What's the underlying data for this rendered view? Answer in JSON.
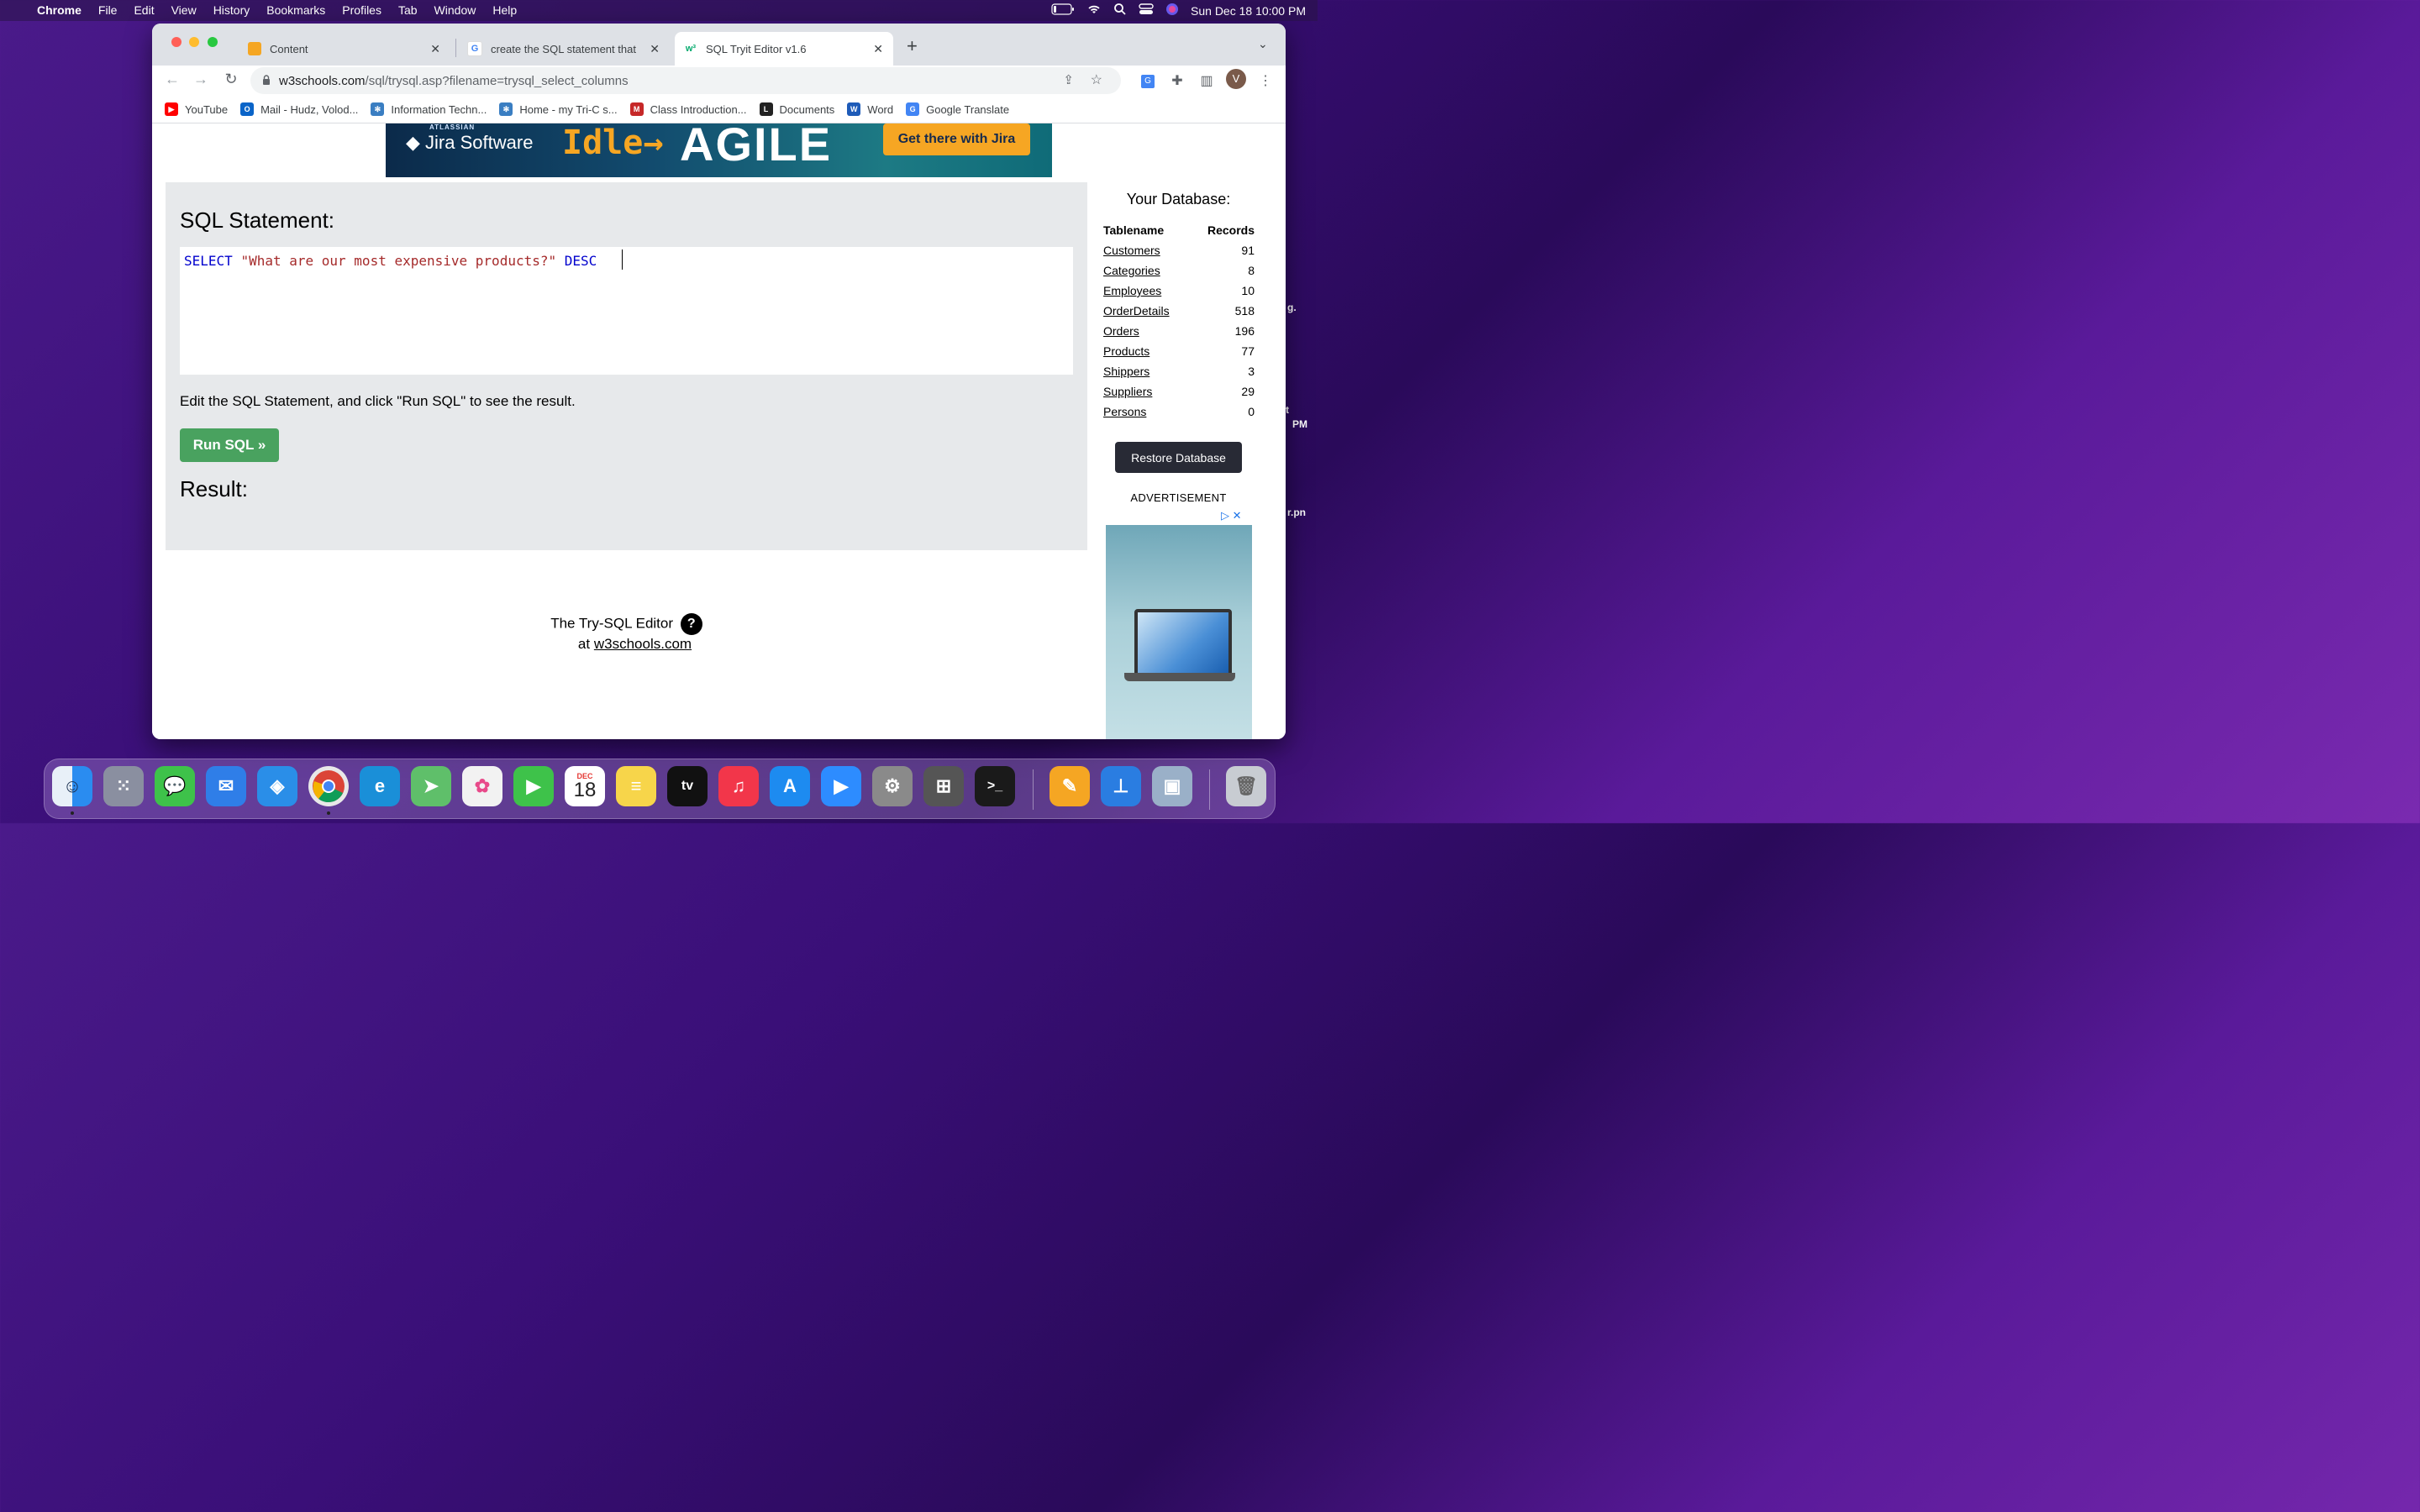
{
  "menubar": {
    "app": "Chrome",
    "items": [
      "File",
      "Edit",
      "View",
      "History",
      "Bookmarks",
      "Profiles",
      "Tab",
      "Window",
      "Help"
    ],
    "datetime": "Sun Dec 18  10:00 PM"
  },
  "desktop_hints": [
    "g.",
    "t",
    "PM",
    "r.pn"
  ],
  "tabs": [
    {
      "title": "Content",
      "favicon_color": "#f5a623"
    },
    {
      "title": "create the SQL statement that",
      "favicon_color": "#4285f4"
    },
    {
      "title": "SQL Tryit Editor v1.6",
      "favicon_color": "#04aa6d"
    }
  ],
  "address": {
    "host": "w3schools.com",
    "path": "/sql/trysql.asp?filename=trysql_select_columns"
  },
  "profile_initial": "V",
  "bookmarks": [
    {
      "label": "YouTube",
      "color": "#ff0000"
    },
    {
      "label": "Mail - Hudz, Volod...",
      "color": "#0a64c8"
    },
    {
      "label": "Information Techn...",
      "color": "#3a7ec2"
    },
    {
      "label": "Home - my Tri-C s...",
      "color": "#3a7ec2"
    },
    {
      "label": "Class Introduction...",
      "color": "#c62828"
    },
    {
      "label": "Documents",
      "color": "#222222"
    },
    {
      "label": "Word",
      "color": "#1e5bb8"
    },
    {
      "label": "Google Translate",
      "color": "#4285f4"
    }
  ],
  "banner": {
    "brand_small": "ATLASSIAN",
    "brand": "Jira Software",
    "word1": "Idle",
    "word2": "AGILE",
    "cta": "Get there with Jira"
  },
  "editor": {
    "heading": "SQL Statement:",
    "code_keyword": "SELECT",
    "code_string": "\"What are our most expensive products?\"",
    "code_keyword2": "DESC",
    "hint": "Edit the SQL Statement, and click \"Run SQL\" to see the result.",
    "run_label": "Run SQL »",
    "result_heading": "Result:"
  },
  "footer": {
    "line1": "The Try-SQL Editor",
    "help": "?",
    "at": "at",
    "link": "w3schools.com"
  },
  "database": {
    "title": "Your Database:",
    "col_name": "Tablename",
    "col_records": "Records",
    "rows": [
      {
        "name": "Customers",
        "records": "91"
      },
      {
        "name": "Categories",
        "records": "8"
      },
      {
        "name": "Employees",
        "records": "10"
      },
      {
        "name": "OrderDetails",
        "records": "518"
      },
      {
        "name": "Orders",
        "records": "196"
      },
      {
        "name": "Products",
        "records": "77"
      },
      {
        "name": "Shippers",
        "records": "3"
      },
      {
        "name": "Suppliers",
        "records": "29"
      },
      {
        "name": "Persons",
        "records": "0"
      }
    ],
    "restore_label": "Restore Database",
    "ad_label": "ADVERTISEMENT"
  },
  "dock": {
    "calendar_month": "DEC",
    "calendar_day": "18",
    "tv_label": "tv",
    "apps": [
      {
        "name": "finder",
        "color": "#2a8cf0"
      },
      {
        "name": "launchpad",
        "color": "#8a8fa0"
      },
      {
        "name": "messages",
        "color": "#3ec24a"
      },
      {
        "name": "mail",
        "color": "#2f7ee8"
      },
      {
        "name": "safari",
        "color": "#2a8ee8"
      },
      {
        "name": "chrome",
        "color": "#e8e8e8"
      },
      {
        "name": "edge",
        "color": "#1a8fd8"
      },
      {
        "name": "maps",
        "color": "#5fbf6a"
      },
      {
        "name": "photos",
        "color": "#f2f2f2"
      },
      {
        "name": "facetime",
        "color": "#3ec24a"
      },
      {
        "name": "calendar",
        "color": "#ffffff"
      },
      {
        "name": "notes",
        "color": "#f7d54a"
      },
      {
        "name": "apple-tv",
        "color": "#111111"
      },
      {
        "name": "music",
        "color": "#f2364a"
      },
      {
        "name": "app-store",
        "color": "#1d8bf0"
      },
      {
        "name": "zoom",
        "color": "#2d8cff"
      },
      {
        "name": "system-preferences",
        "color": "#8a8a8a"
      },
      {
        "name": "calculator",
        "color": "#555555"
      },
      {
        "name": "terminal",
        "color": "#1a1a1a"
      },
      {
        "name": "pages",
        "color": "#f5a623"
      },
      {
        "name": "keynote",
        "color": "#2a7de1"
      },
      {
        "name": "preview",
        "color": "#9ab0c8"
      },
      {
        "name": "trash",
        "color": "#c8ccd2"
      }
    ]
  }
}
